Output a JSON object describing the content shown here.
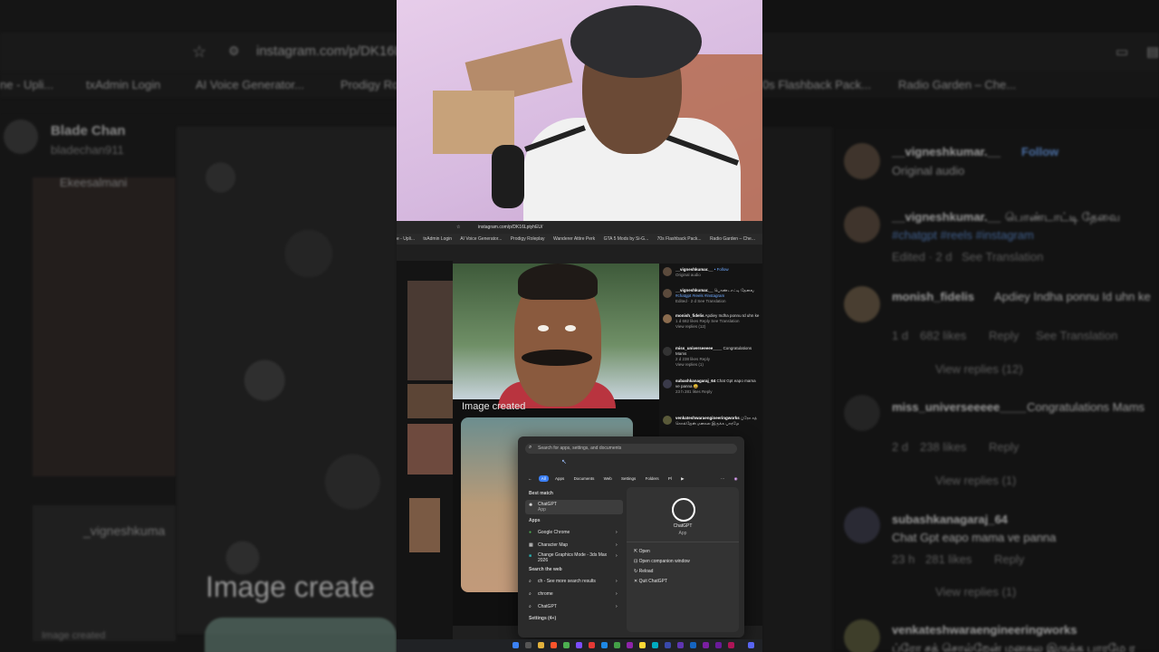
{
  "background": {
    "url": "instagram.com/p/DK16L",
    "bookmarks": [
      "ne - Upli...",
      "txAdmin Login",
      "AI Voice Generator...",
      "Prodigy Ro",
      "0s Flashback Pack...",
      "Radio Garden – Che..."
    ],
    "left_profile": {
      "name": "Blade Chan",
      "handle": "bladechan911",
      "tag": "Ekeesalmani",
      "image_created": "Image create",
      "caption_user": "_vigneshkuma",
      "image_created_small": "Image created"
    },
    "right_comments": [
      {
        "user": "__vigneshkumar.__",
        "follow": "Follow",
        "text": "Original audio"
      },
      {
        "user": "__vigneshkumar.__",
        "text": "பொண்டாட்டி தேவை",
        "hashtags": "#chatgpt #reels #instagram",
        "meta": "Edited · 2 d",
        "translate": "See Translation"
      },
      {
        "user": "monish_fidelis",
        "text": "Apdiey Indha ponnu Id uhn ke",
        "age": "1 d",
        "likes": "682 likes",
        "reply": "Reply",
        "translate": "See Translation",
        "view": "View replies (12)"
      },
      {
        "user": "miss_universeeeee____",
        "text": "Congratulations Mams",
        "age": "2 d",
        "likes": "238 likes",
        "reply": "Reply",
        "view": "View replies (1)"
      },
      {
        "user": "subashkanagaraj_64",
        "text": "Chat Gpt eapo mama ve panna",
        "age": "23 h",
        "likes": "281 likes",
        "reply": "Reply",
        "view": "View replies (1)"
      },
      {
        "user": "venkateshwaraengineeringworks",
        "text": "ப்ரோ சத் சொல்றேன் மனசுல இருக்க பாரமே ர"
      }
    ]
  },
  "screen": {
    "url": "instagram.com/p/DK16LptyhEU/",
    "bookmarks": [
      "e - Upli...",
      "txAdmin Login",
      "AI Voice Generator...",
      "Prodigy Roleplay",
      "Wanderer Attire Perk",
      "GTA 5 Mods by Si-G...",
      "70s Flashback Pack...",
      "Radio Garden – Che..."
    ],
    "image_created": "Image created",
    "comments": [
      {
        "user": "__vigneshkumar.__",
        "follow": "• Follow",
        "text": "Original audio"
      },
      {
        "user": "__vigneshkumar.__",
        "text": "பொண்டாட்டி தேவை",
        "hashtags": "#chatgpt #reels #instagram",
        "meta": "Edited · 2 d   See Translation"
      },
      {
        "user": "monish_fidelis",
        "text": "Apdiey Indha ponnu Id uhn ke",
        "meta": "1 d   682 likes   Reply   See Translation",
        "view": "View replies (12)"
      },
      {
        "user": "miss_universeeeee____",
        "text": "Congratulations Mams",
        "meta": "2 d   238 likes   Reply",
        "view": "View replies (1)"
      },
      {
        "user": "subashkanagaraj_64",
        "text": "Chat Gpt eapo mama ve panna 😄",
        "meta": "23 h   281 likes   Reply",
        "view": "View replies (1)"
      },
      {
        "user": "venkateshwaraengineeringworks",
        "text": "ப்ரோ சத் சொல்றேன் மனசுல இருக்க பாரமே"
      }
    ],
    "startmenu": {
      "search_placeholder": "Search for apps, settings, and documents",
      "tabs": [
        "All",
        "Apps",
        "Documents",
        "Web",
        "Settings",
        "Folders",
        "Pl"
      ],
      "best_match_label": "Best match",
      "best_match": {
        "name": "ChatGPT",
        "sub": "App"
      },
      "apps_label": "Apps",
      "apps": [
        "Google Chrome",
        "Character Map",
        "Change Graphics Mode - 3ds Max 2026"
      ],
      "web_label": "Search the web",
      "web": [
        "ch - See more search results",
        "chrome",
        "ChatGPT"
      ],
      "settings_label": "Settings (4+)",
      "detail": {
        "name": "ChatGPT",
        "sub": "App",
        "actions": [
          "Open",
          "Open companion window",
          "Reload",
          "Quit ChatGPT"
        ]
      }
    }
  }
}
